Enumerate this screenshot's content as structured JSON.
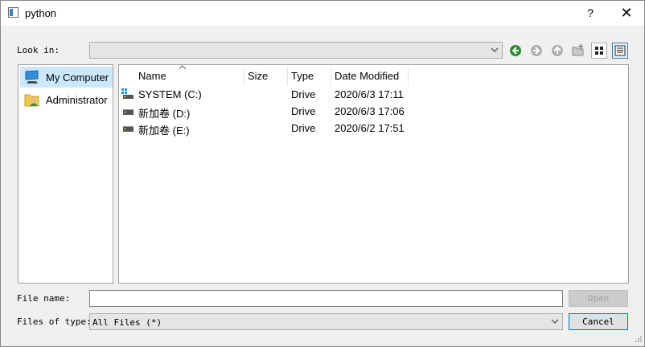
{
  "window": {
    "title": "python",
    "help_label": "?",
    "close_label": "✕"
  },
  "look_in": {
    "label": "Look in:",
    "value": ""
  },
  "toolbar": {
    "icons": [
      "back-arrow-icon",
      "forward-arrow-icon",
      "up-arrow-icon",
      "new-folder-icon",
      "list-view-icon",
      "detail-view-icon"
    ],
    "active_view": "detail-view"
  },
  "sidebar": {
    "items": [
      {
        "label": "My Computer",
        "icon": "computer-icon",
        "selected": true
      },
      {
        "label": "Administrator",
        "icon": "user-folder-icon",
        "selected": false
      }
    ]
  },
  "columns": [
    "Name",
    "Size",
    "Type",
    "Date Modified"
  ],
  "files": [
    {
      "name": "SYSTEM (C:)",
      "size": "",
      "type": "Drive",
      "modified": "2020/6/3 17:11",
      "icon": "system-drive-icon"
    },
    {
      "name": "新加卷 (D:)",
      "size": "",
      "type": "Drive",
      "modified": "2020/6/3 17:06",
      "icon": "drive-icon"
    },
    {
      "name": "新加卷 (E:)",
      "size": "",
      "type": "Drive",
      "modified": "2020/6/2 17:51",
      "icon": "drive-icon"
    }
  ],
  "file_name": {
    "label": "File name:",
    "value": ""
  },
  "file_type": {
    "label": "Files of type:",
    "value": "All Files (*)"
  },
  "buttons": {
    "open": "Open",
    "cancel": "Cancel"
  },
  "colors": {
    "accent": "#0078d7",
    "selection": "#cce8ff",
    "nav_green": "#2e8b2e"
  }
}
